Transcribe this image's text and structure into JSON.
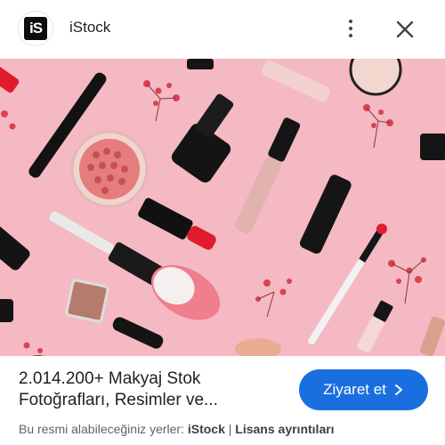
{
  "header": {
    "logo_text": "iS",
    "site_name": "iStock"
  },
  "image": {
    "background": "#f5b9c4",
    "description_icon": "lens-icon"
  },
  "result": {
    "title_line1": "2.014.200+ Makyaj Stok",
    "title_line2": "Fotoğrafları, Resimler ve...",
    "visit_label": "Ziyaret et",
    "source_prefix": "Bu resmi alabileceğiniz yerler: ",
    "source_name": "iStock",
    "separator": " | ",
    "license_link": "Lisans ayrıntıları"
  },
  "colors": {
    "accent": "#1a6fe0",
    "text": "#202124",
    "muted": "#5f6368"
  }
}
